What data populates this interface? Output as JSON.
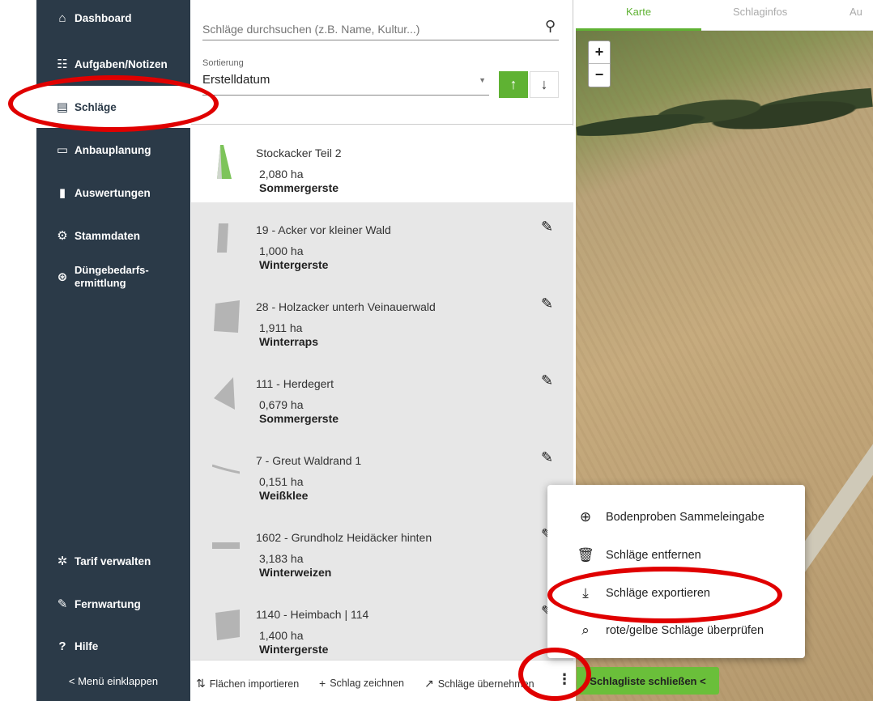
{
  "sidebar": {
    "items": [
      {
        "label": "Dashboard",
        "icon": "home-icon"
      },
      {
        "label": "Aufgaben/Notizen",
        "icon": "tasks-icon"
      },
      {
        "label": "Schläge",
        "icon": "clipboard-icon"
      },
      {
        "label": "Anbauplanung",
        "icon": "calendar-icon"
      },
      {
        "label": "Auswertungen",
        "icon": "bar-chart-icon"
      },
      {
        "label": "Stammdaten",
        "icon": "tractor-icon"
      },
      {
        "label": "Düngebedarfs-",
        "label2": "ermittlung",
        "icon": "fertilizer-icon"
      }
    ],
    "bottom_items": [
      {
        "label": "Tarif verwalten",
        "icon": "tariff-gear-icon"
      },
      {
        "label": "Fernwartung",
        "icon": "remote-icon"
      },
      {
        "label": "Hilfe",
        "icon": "help-icon"
      }
    ],
    "collapse_label": "< Menü einklappen"
  },
  "search": {
    "placeholder": "Schläge durchsuchen (z.B. Name, Kultur...)"
  },
  "sort": {
    "label": "Sortierung",
    "value": "Erstelldatum",
    "asc": "↑",
    "desc": "↓"
  },
  "fields": [
    {
      "name": "Stockacker Teil 2",
      "area": "2,080 ha",
      "crop": "Sommergerste"
    },
    {
      "name": "19 - Acker vor kleiner Wald",
      "area": "1,000 ha",
      "crop": "Wintergerste"
    },
    {
      "name": "28 - Holzacker unterh Veinauerwald",
      "area": "1,911 ha",
      "crop": "Winterraps"
    },
    {
      "name": "111 - Herdegert",
      "area": "0,679 ha",
      "crop": "Sommergerste"
    },
    {
      "name": "7 - Greut Waldrand 1",
      "area": "0,151 ha",
      "crop": "Weißklee"
    },
    {
      "name": "1602 - Grundholz Heidäcker hinten",
      "area": "3,183 ha",
      "crop": "Winterweizen"
    },
    {
      "name": "1140 - Heimbach | 114",
      "area": "1,400 ha",
      "crop": "Wintergerste"
    }
  ],
  "footer": {
    "import": "Flächen importieren",
    "draw": "Schlag zeichnen",
    "take_over": "Schläge übernehmen",
    "more": "⋮"
  },
  "map": {
    "tabs": [
      "Karte",
      "Schlaginfos",
      "Au"
    ],
    "zoom_in": "+",
    "zoom_out": "−",
    "close_list": "Schlagliste schließen <"
  },
  "menu": {
    "items": [
      {
        "label": "Bodenproben Sammeleingabe",
        "icon": "add-circle-icon"
      },
      {
        "label": "Schläge entfernen",
        "icon": "delete-list-icon"
      },
      {
        "label": "Schläge exportieren",
        "icon": "download-icon"
      },
      {
        "label": "rote/gelbe Schläge überprüfen",
        "icon": "search-check-icon"
      }
    ]
  },
  "colors": {
    "sidebar": "#2b3a48",
    "accent": "#5fb233",
    "highlight": "#e00000"
  }
}
